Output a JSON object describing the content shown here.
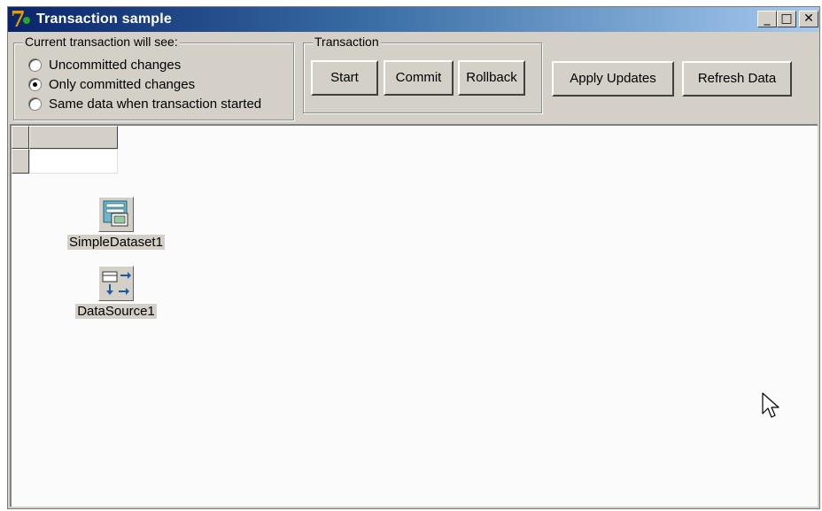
{
  "window": {
    "title": "Transaction sample",
    "controls": {
      "minimize": "_",
      "maximize": "□",
      "close": "✕"
    }
  },
  "isolation_group": {
    "legend": "Current transaction will see:",
    "options": [
      {
        "label": "Uncommitted changes",
        "checked": false
      },
      {
        "label": "Only committed changes",
        "checked": true
      },
      {
        "label": "Same data when transaction started",
        "checked": false
      }
    ]
  },
  "transaction_group": {
    "legend": "Transaction",
    "buttons": {
      "start": "Start",
      "commit": "Commit",
      "rollback": "Rollback"
    }
  },
  "actions": {
    "apply_updates": "Apply Updates",
    "refresh_data": "Refresh Data"
  },
  "components": [
    {
      "name": "SimpleDataset1",
      "icon": "dataset-icon"
    },
    {
      "name": "DataSource1",
      "icon": "datasource-icon"
    }
  ],
  "colors": {
    "title_gradient_start": "#0a246a",
    "title_gradient_end": "#a6caf0",
    "face": "#d4d0c8",
    "client": "#fbfbfb"
  }
}
